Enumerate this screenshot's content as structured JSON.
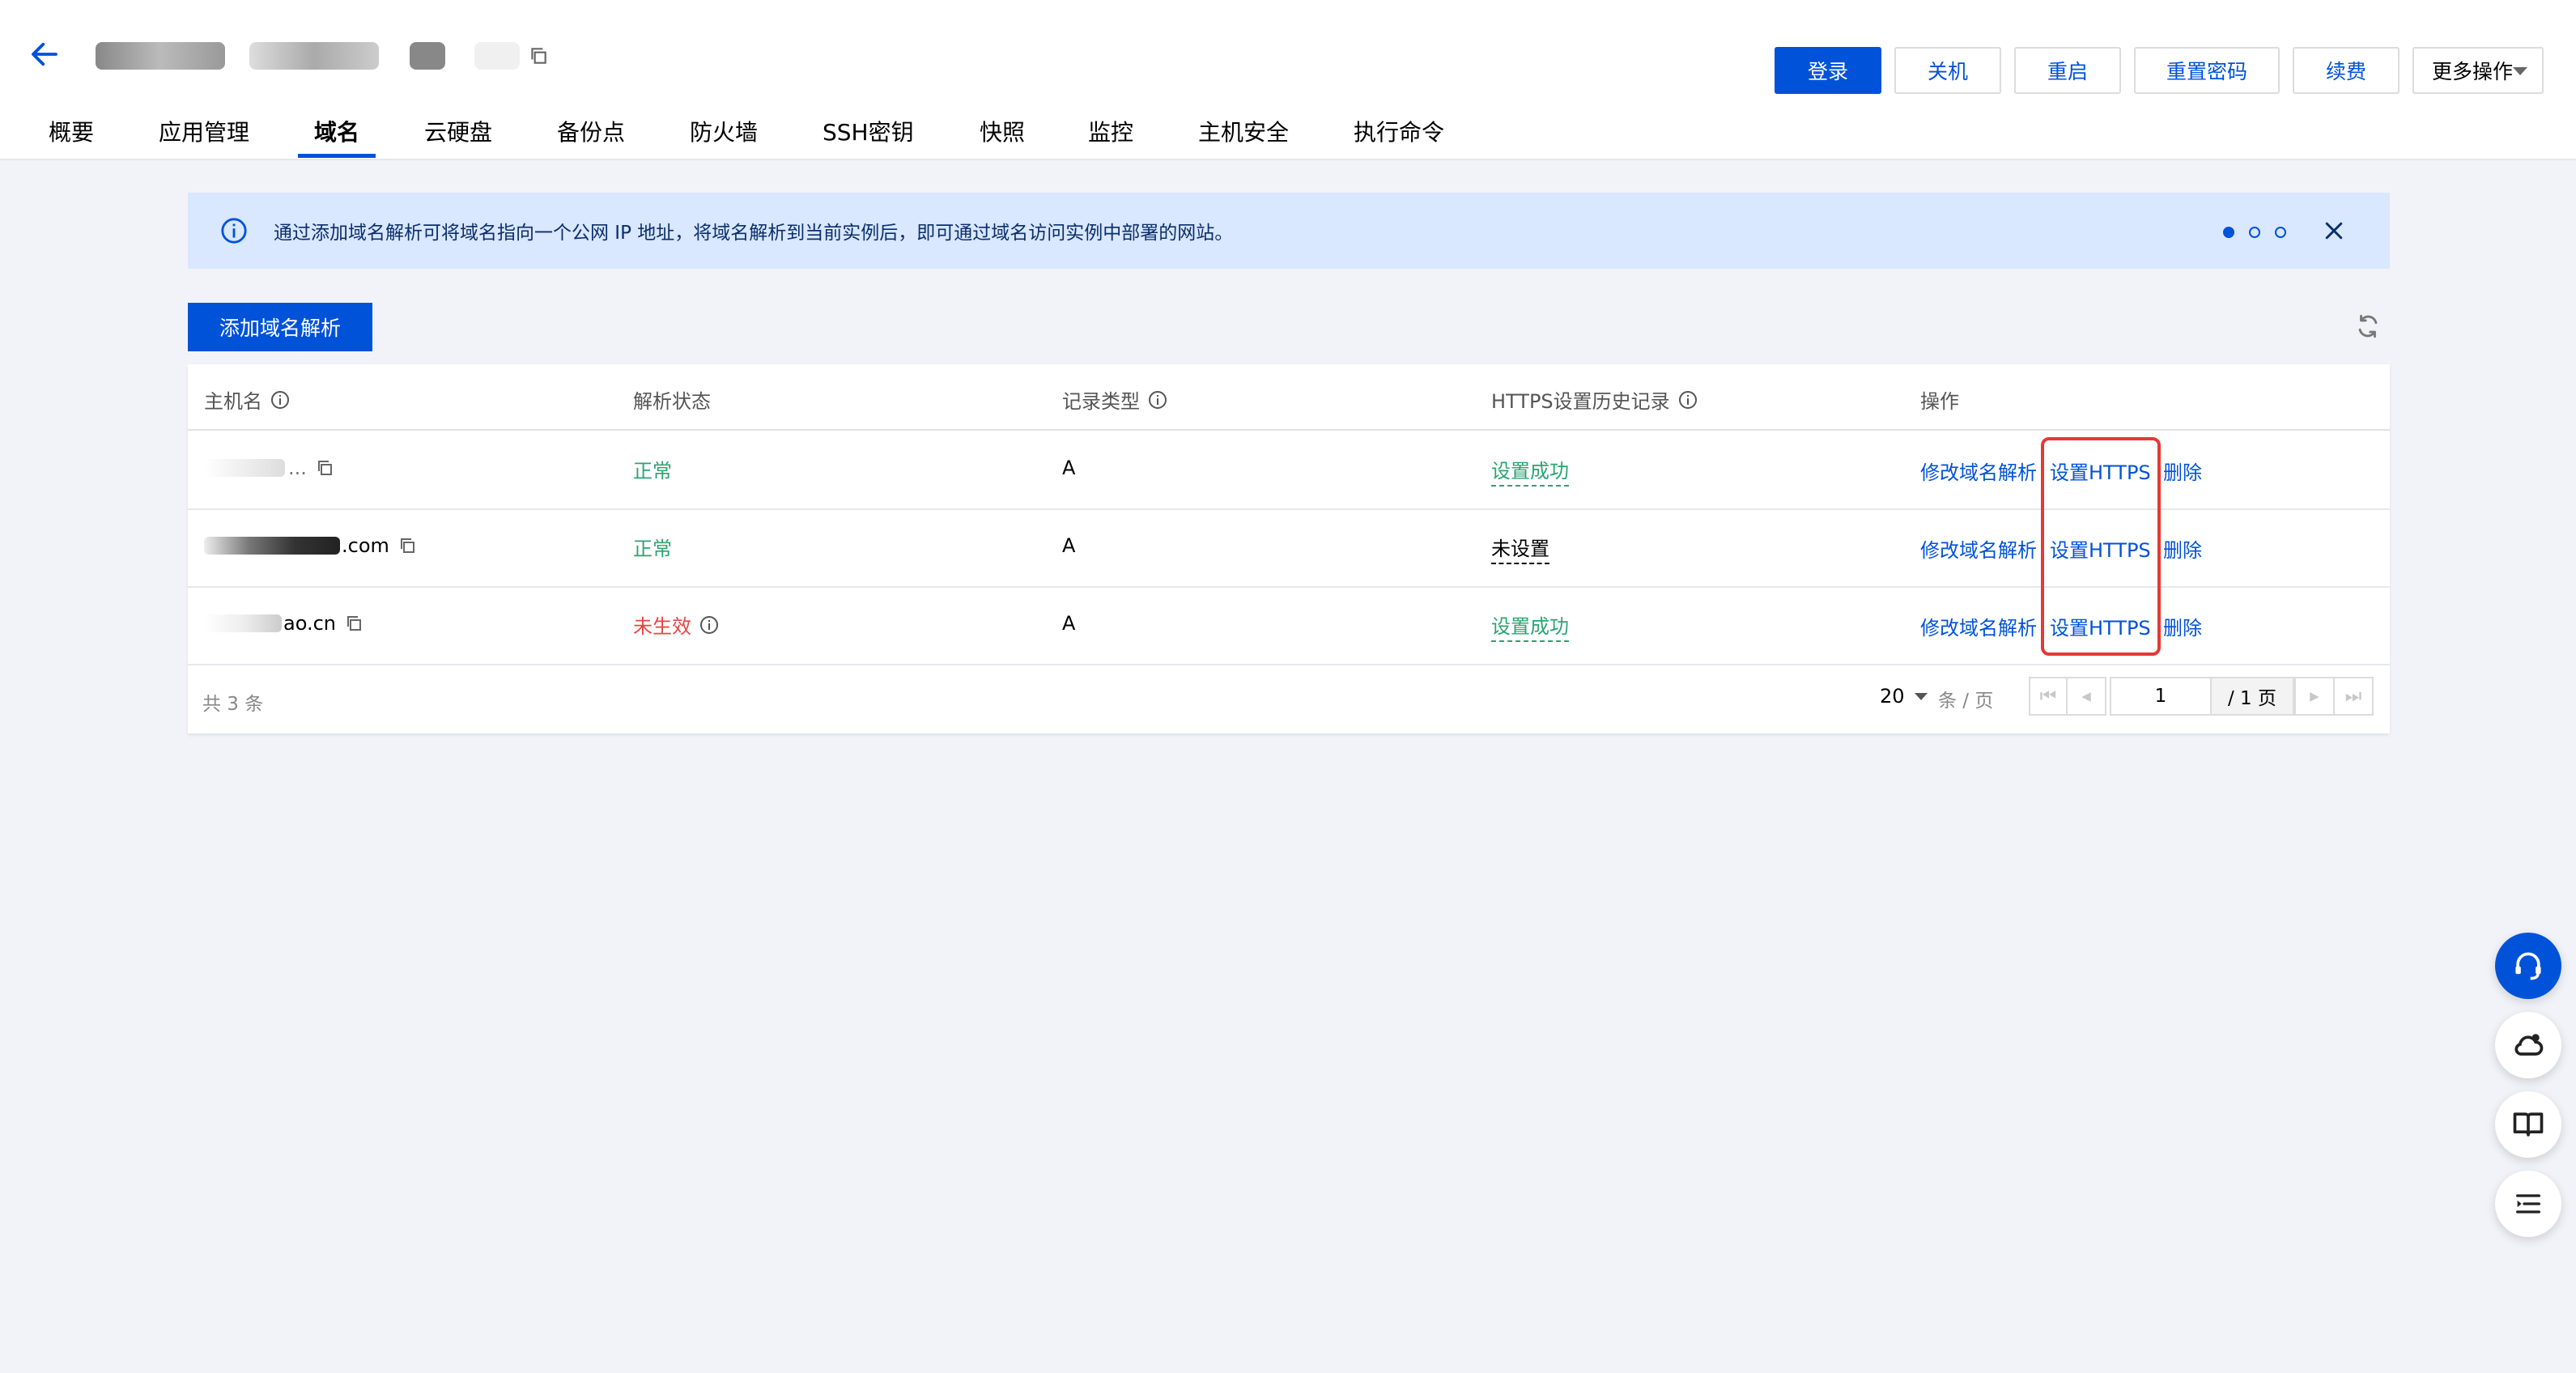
{
  "header": {
    "buttons": {
      "login": "登录",
      "shutdown": "关机",
      "restart": "重启",
      "reset_password": "重置密码",
      "renew": "续费",
      "more": "更多操作"
    }
  },
  "tabs": [
    {
      "label": "概要"
    },
    {
      "label": "应用管理"
    },
    {
      "label": "域名"
    },
    {
      "label": "云硬盘"
    },
    {
      "label": "备份点"
    },
    {
      "label": "防火墙"
    },
    {
      "label": "SSH密钥"
    },
    {
      "label": "快照"
    },
    {
      "label": "监控"
    },
    {
      "label": "主机安全"
    },
    {
      "label": "执行命令"
    }
  ],
  "notice": {
    "text": "通过添加域名解析可将域名指向一个公网 IP 地址，将域名解析到当前实例后，即可通过域名访问实例中部署的网站。"
  },
  "toolbar": {
    "add_label": "添加域名解析"
  },
  "table": {
    "headers": {
      "host": "主机名",
      "status": "解析状态",
      "type": "记录类型",
      "https": "HTTPS设置历史记录",
      "ops": "操作"
    },
    "rows": [
      {
        "host": "...",
        "status": "正常",
        "type": "A",
        "https": "设置成功",
        "op_edit": "修改域名解析",
        "op_https": "设置HTTPS",
        "op_delete": "删除"
      },
      {
        "host": ".com",
        "status": "正常",
        "type": "A",
        "https": "未设置",
        "op_edit": "修改域名解析",
        "op_https": "设置HTTPS",
        "op_delete": "删除"
      },
      {
        "host": "ao.cn",
        "status": "未生效",
        "type": "A",
        "https": "设置成功",
        "op_edit": "修改域名解析",
        "op_https": "设置HTTPS",
        "op_delete": "删除"
      }
    ]
  },
  "pagination": {
    "total": "共 3 条",
    "page_size": "20",
    "unit": "条 / 页",
    "current_page": "1",
    "total_pages": "/ 1 页"
  },
  "colors": {
    "primary": "#0052d9",
    "success": "#2ba471",
    "error": "#e54545",
    "highlight_box": "#e53935"
  }
}
